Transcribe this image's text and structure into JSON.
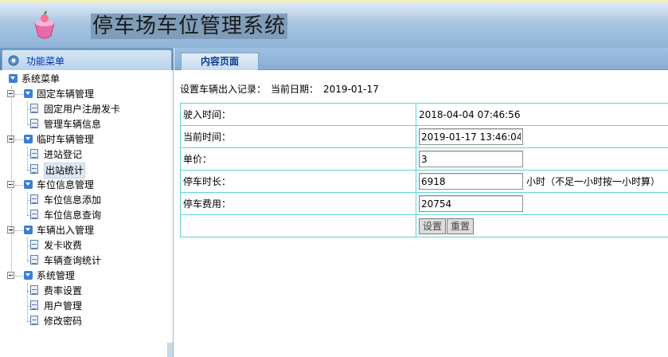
{
  "header": {
    "title": "停车场车位管理系统"
  },
  "sidebar": {
    "tab_label": "功能菜单",
    "root_label": "系统菜单",
    "groups": [
      {
        "label": "固定车辆管理",
        "items": [
          "固定用户注册发卡",
          "管理车辆信息"
        ]
      },
      {
        "label": "临时车辆管理",
        "items": [
          "进站登记",
          "出站统计"
        ]
      },
      {
        "label": "车位信息管理",
        "items": [
          "车位信息添加",
          "车位信息查询"
        ]
      },
      {
        "label": "车辆出入管理",
        "items": [
          "发卡收费",
          "车辆查询统计"
        ]
      },
      {
        "label": "系统管理",
        "items": [
          "费率设置",
          "用户管理",
          "修改密码"
        ]
      }
    ],
    "selected_item": "出站统计"
  },
  "content": {
    "tab_label": "内容页面",
    "record_label": "设置车辆出入记录：",
    "date_label": "当前日期：",
    "date_value": "2019-01-17"
  },
  "form": {
    "entry_time_label": "驶入时间：",
    "entry_time_value": "2018-04-04 07:46:56",
    "current_time_label": "当前时间：",
    "current_time_value": "2019-01-17 13:46:04",
    "unit_price_label": "单价：",
    "unit_price_value": "3",
    "duration_label": "停车时长：",
    "duration_value": "6918",
    "duration_unit": "小时（不足一小时按一小时算）",
    "fee_label": "停车费用：",
    "fee_value": "20754",
    "set_button": "设置",
    "reset_button": "重置"
  },
  "colors": {
    "header_bg": "#8fb3d6",
    "table_border": "#5fd4d4",
    "tab_text": "#0a3c8c"
  }
}
